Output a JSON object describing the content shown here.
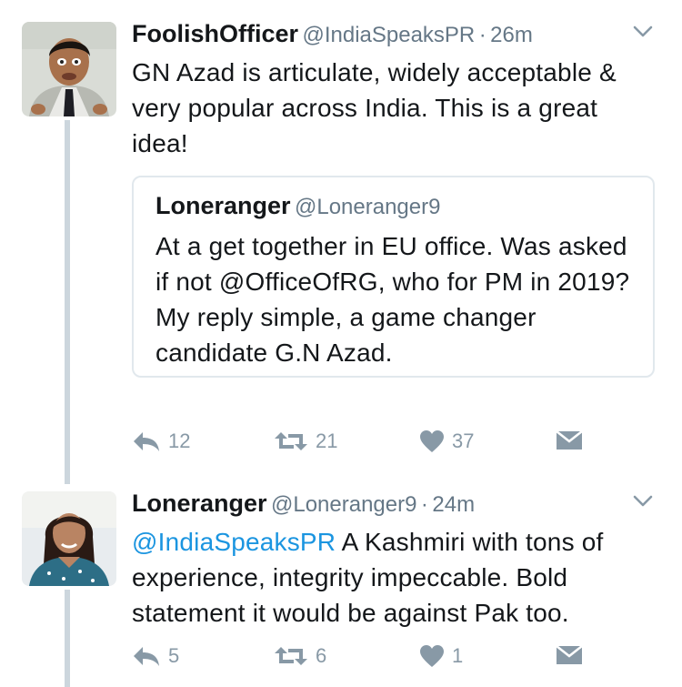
{
  "tweets": [
    {
      "display_name": "FoolishOfficer",
      "handle": "@IndiaSpeaksPR",
      "separator": "·",
      "time": "26m",
      "text": "GN Azad is articulate, widely acceptable & very popular across India. This is a great idea!",
      "avatar_icon": "avatar-man-icon",
      "quoted": {
        "display_name": "Loneranger",
        "handle": "@Loneranger9",
        "text": "At a get together in EU office. Was asked if not @OfficeOfRG, who for PM in 2019? My reply simple, a game changer candidate G.N Azad."
      },
      "actions": {
        "replies": "12",
        "retweets": "21",
        "likes": "37"
      }
    },
    {
      "display_name": "Loneranger",
      "handle": "@Loneranger9",
      "separator": "·",
      "time": "24m",
      "mention": "@IndiaSpeaksPR",
      "text": " A Kashmiri with tons of experience, integrity impeccable. Bold statement it would be against Pak too.",
      "avatar_icon": "avatar-woman-icon",
      "actions": {
        "replies": "5",
        "retweets": "6",
        "likes": "1"
      }
    }
  ],
  "colors": {
    "text": "#14171a",
    "secondary": "#657786",
    "action": "#8899a6",
    "link": "#1b95e0",
    "thread_line": "#ccd6dd",
    "border": "#e1e8ed"
  }
}
